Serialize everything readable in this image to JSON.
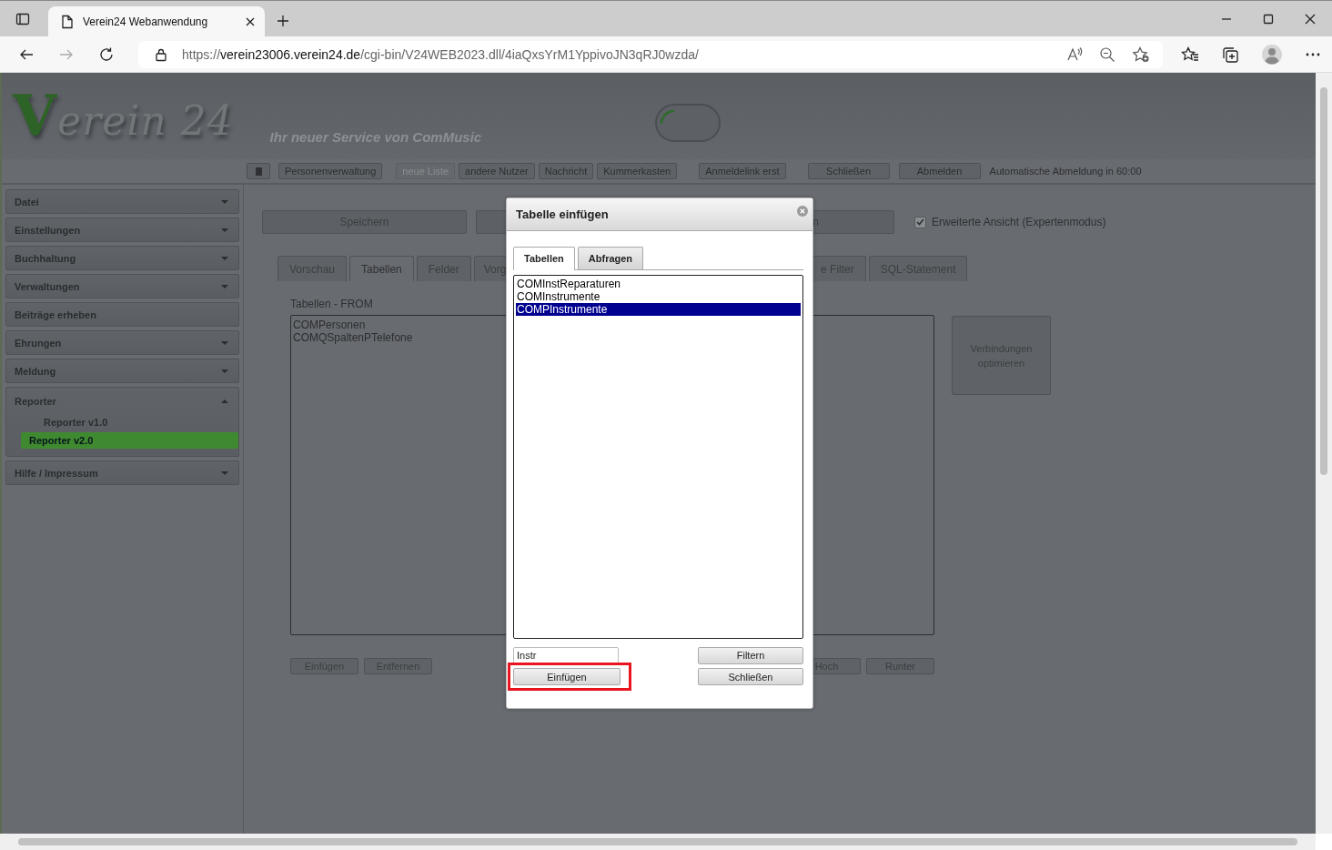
{
  "browser": {
    "tab_title": "Verein24 Webanwendung",
    "url": {
      "scheme": "https://",
      "host": "verein23006.verein24.de",
      "path": "/cgi-bin/V24WEB2023.dll/4iaQxsYrM1YppivoJN3qRJ0wzda/"
    }
  },
  "header": {
    "logo": "Verein 24",
    "tagline": "Ihr neuer Service von ComMusic",
    "toggle": {
      "on": false
    }
  },
  "toolbar": {
    "buttons": [
      {
        "kind": "icon",
        "disabled": false
      },
      {
        "kind": "text",
        "label": "Personenverwaltung",
        "disabled": false
      },
      {
        "kind": "text",
        "label": "neue Liste",
        "disabled": true
      },
      {
        "kind": "text",
        "label": "andere Nutzer",
        "disabled": false
      },
      {
        "kind": "text",
        "label": "Nachricht",
        "disabled": false
      },
      {
        "kind": "text",
        "label": "Kummerkasten",
        "disabled": false
      },
      {
        "kind": "text",
        "label": "Anmeldelink erst",
        "disabled": false
      },
      {
        "kind": "text",
        "label": "Schließen",
        "disabled": false
      },
      {
        "kind": "text",
        "label": "Abmelden",
        "disabled": false
      }
    ],
    "logout_notice": "Automatische Abmeldung in 60:00"
  },
  "sidebar": {
    "items": [
      {
        "kind": "menu",
        "label": "Datei",
        "expanded": false
      },
      {
        "kind": "menu",
        "label": "Einstellungen",
        "expanded": false
      },
      {
        "kind": "menu",
        "label": "Buchhaltung",
        "expanded": false
      },
      {
        "kind": "menu",
        "label": "Verwaltungen",
        "expanded": false
      },
      {
        "kind": "link",
        "label": "Beiträge erheben"
      },
      {
        "kind": "menu",
        "label": "Ehrungen",
        "expanded": false
      },
      {
        "kind": "menu",
        "label": "Meldung",
        "expanded": false
      },
      {
        "kind": "menu",
        "label": "Reporter",
        "expanded": true,
        "children": [
          {
            "label": "Reporter v1.0",
            "selected": false
          },
          {
            "label": "Reporter v2.0",
            "selected": true
          }
        ]
      },
      {
        "kind": "menu",
        "label": "Hilfe / Impressum",
        "expanded": false
      }
    ]
  },
  "main": {
    "action_buttons": [
      {
        "kind": "full",
        "label": "Speichern"
      },
      {
        "kind": "covered"
      },
      {
        "kind": "cut_left",
        "label": "n"
      }
    ],
    "expert_mode": {
      "label": "Erweiterte Ansicht (Expertenmodus)",
      "checked": true
    },
    "tabs": [
      {
        "kind": "full",
        "label": "Vorschau",
        "selected": false
      },
      {
        "kind": "full",
        "label": "Tabellen",
        "selected": true
      },
      {
        "kind": "full",
        "label": "Felder",
        "selected": false
      },
      {
        "kind": "cut_right",
        "label": "Vorg",
        "selected": false
      },
      {
        "kind": "cut_left",
        "label": "e Filter",
        "selected": false
      },
      {
        "kind": "full",
        "label": "SQL-Statement",
        "selected": false
      }
    ],
    "tables_label": "Tabellen - FROM",
    "tables": [
      "COMPersonen",
      "COMQSpaltenPTelefone"
    ],
    "side_button": "Verbindungen optimieren",
    "bottom_buttons": [
      {
        "kind": "full",
        "label": "Einfügen"
      },
      {
        "kind": "full",
        "label": "Entfernen"
      },
      {
        "kind": "cut_left",
        "label": "Hoch"
      },
      {
        "kind": "full",
        "label": "Runter"
      }
    ]
  },
  "dialog": {
    "title": "Tabelle einfügen",
    "tabs": [
      {
        "label": "Tabellen",
        "selected": true
      },
      {
        "label": "Abfragen",
        "selected": false
      }
    ],
    "items": [
      {
        "label": "COMInstReparaturen",
        "selected": false
      },
      {
        "label": "COMInstrumente",
        "selected": false
      },
      {
        "label": "COMPInstrumente",
        "selected": true
      }
    ],
    "filter": {
      "value": "Instr"
    },
    "buttons": [
      {
        "label": "Filtern",
        "highlighted": false
      },
      {
        "label": "Einfügen",
        "highlighted": true
      },
      {
        "label": "Schließen",
        "highlighted": false
      }
    ]
  }
}
